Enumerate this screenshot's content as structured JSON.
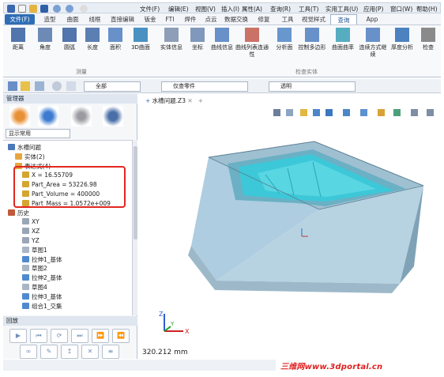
{
  "quickaccess": {
    "menus": [
      "文件(F)",
      "编辑(E)",
      "视图(V)",
      "插入(I)",
      "属性(A)",
      "查询(R)",
      "工具(T)",
      "实用工具(U)",
      "应用(P)",
      "窗口(W)",
      "帮助(H)"
    ]
  },
  "ribbon_tabs": [
    "文件(F)",
    "造型",
    "曲面",
    "线框",
    "直接编辑",
    "钣金",
    "FTI",
    "焊件",
    "点云",
    "数据交换",
    "修复",
    "工具",
    "视觉样式",
    "查询",
    "App"
  ],
  "active_tab": "查询",
  "ribbon": {
    "buttons": [
      "距离",
      "角度",
      "圆弧",
      "长度",
      "面积",
      "3D曲面",
      "实体信息",
      "坐标",
      "曲线信息",
      "曲线列表连通性",
      "分析面",
      "控制多边形",
      "曲面曲率",
      "连续方式继续",
      "厚度分析",
      "检查"
    ],
    "groups": [
      "测量",
      "检查实体"
    ]
  },
  "toolbar": {
    "combo1": "全部",
    "combo2": "仅查零件",
    "combo3": "透明"
  },
  "manager": {
    "title": "管理器",
    "filter": "显示常用",
    "tree": [
      {
        "label": "水槽问题",
        "indent": 0
      },
      {
        "label": "实体(2)",
        "indent": 1
      },
      {
        "label": "表达式(4)",
        "indent": 1
      },
      {
        "label": "X = 16.55709",
        "indent": 2
      },
      {
        "label": "Part_Area = 53226.98",
        "indent": 2
      },
      {
        "label": "Part_Volume = 400000",
        "indent": 2
      },
      {
        "label": "Part_Mass = 1.0572e+009",
        "indent": 2
      },
      {
        "label": "历史",
        "indent": 0
      },
      {
        "label": "XY",
        "indent": 2
      },
      {
        "label": "XZ",
        "indent": 2
      },
      {
        "label": "YZ",
        "indent": 2
      },
      {
        "label": "草图1",
        "indent": 2
      },
      {
        "label": "拉伸1_基体",
        "indent": 2
      },
      {
        "label": "草图2",
        "indent": 2
      },
      {
        "label": "拉伸2_基体",
        "indent": 2
      },
      {
        "label": "草图4",
        "indent": 2
      },
      {
        "label": "拉伸3_基体",
        "indent": 2
      },
      {
        "label": "组合1_交集",
        "indent": 2
      }
    ],
    "playback_title": "回放"
  },
  "viewport": {
    "tab": "水槽问题.Z3",
    "distance": "320.212 mm",
    "axis": {
      "x": "X",
      "y": "Y",
      "z": "Z"
    }
  },
  "watermark": "三维网www.3dportal.cn",
  "colors": {
    "accent": "#2f6db5",
    "highlight": "#e2261f",
    "model_body": "#a8c7d6",
    "model_water": "#3cc8d8"
  }
}
